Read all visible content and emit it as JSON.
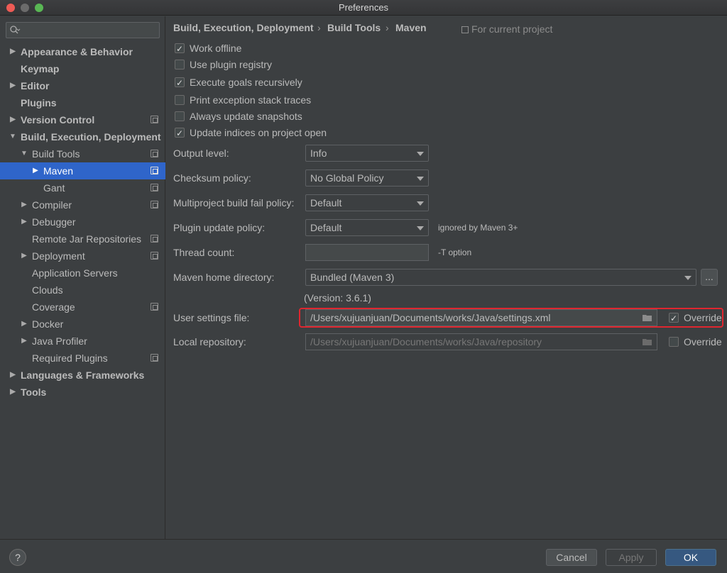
{
  "window": {
    "title": "Preferences"
  },
  "search": {
    "placeholder": "",
    "icon": "search-icon"
  },
  "sidebar": {
    "items": [
      {
        "label": "Appearance & Behavior"
      },
      {
        "label": "Keymap"
      },
      {
        "label": "Editor"
      },
      {
        "label": "Plugins"
      },
      {
        "label": "Version Control"
      },
      {
        "label": "Build, Execution, Deployment"
      },
      {
        "label": "Build Tools"
      },
      {
        "label": "Maven"
      },
      {
        "label": "Gant"
      },
      {
        "label": "Compiler"
      },
      {
        "label": "Debugger"
      },
      {
        "label": "Remote Jar Repositories"
      },
      {
        "label": "Deployment"
      },
      {
        "label": "Application Servers"
      },
      {
        "label": "Clouds"
      },
      {
        "label": "Coverage"
      },
      {
        "label": "Docker"
      },
      {
        "label": "Java Profiler"
      },
      {
        "label": "Required Plugins"
      },
      {
        "label": "Languages & Frameworks"
      },
      {
        "label": "Tools"
      }
    ],
    "selected_color": "#2f65ca"
  },
  "breadcrumb": {
    "items": [
      "Build, Execution, Deployment",
      "Build Tools",
      "Maven"
    ],
    "separator": "›",
    "scope": "For current project"
  },
  "checkboxes": [
    {
      "label": "Work offline",
      "checked": true
    },
    {
      "label": "Use plugin registry",
      "checked": false
    },
    {
      "label": "Execute goals recursively",
      "checked": true
    },
    {
      "label": "Print exception stack traces",
      "checked": false
    },
    {
      "label": "Always update snapshots",
      "checked": false
    },
    {
      "label": "Update indices on project open",
      "checked": true
    }
  ],
  "fields": {
    "output_level": {
      "label": "Output level:",
      "value": "Info"
    },
    "checksum_policy": {
      "label": "Checksum policy:",
      "value": "No Global Policy"
    },
    "multiproject": {
      "label": "Multiproject build fail policy:",
      "value": "Default"
    },
    "plugin_update": {
      "label": "Plugin update policy:",
      "value": "Default",
      "hint": "ignored by Maven 3+"
    },
    "thread_count": {
      "label": "Thread count:",
      "value": "",
      "hint": "-T option"
    },
    "maven_home": {
      "label": "Maven home directory:",
      "value": "Bundled (Maven 3)",
      "browse": "...",
      "version": "(Version: 3.6.1)"
    },
    "user_settings": {
      "label": "User settings file:",
      "value": "/Users/xujuanjuan/Documents/works/Java/settings.xml",
      "override_label": "Override",
      "override_checked": true
    },
    "local_repo": {
      "label": "Local repository:",
      "value": "/Users/xujuanjuan/Documents/works/Java/repository",
      "override_label": "Override",
      "override_checked": false
    }
  },
  "footer": {
    "help": "?",
    "cancel": "Cancel",
    "apply": "Apply",
    "ok": "OK"
  },
  "colors": {
    "highlight": "#e0262f",
    "primary_button": "#365880"
  }
}
